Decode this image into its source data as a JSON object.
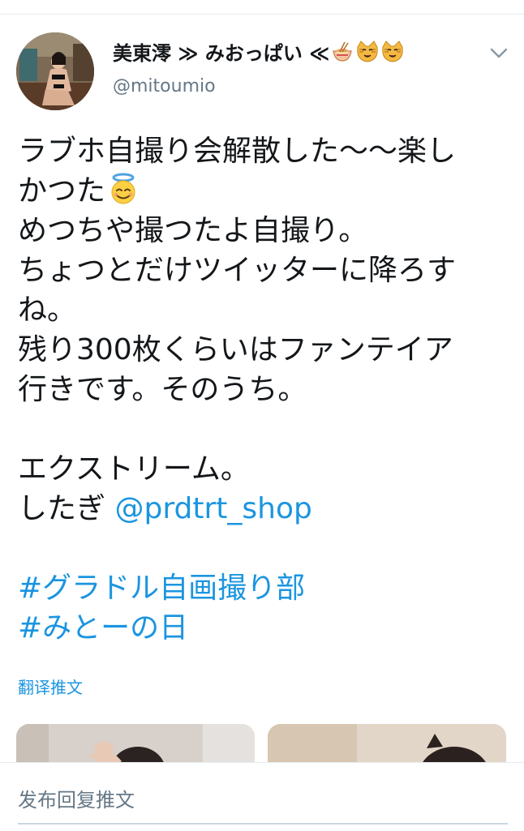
{
  "user": {
    "display_name": "美東澪 ≫ みおっぱい ≪",
    "name_emojis": [
      "ramen-bowl-emoji",
      "cat-face-emoji",
      "cat-face-emoji"
    ],
    "handle": "@mitoumio"
  },
  "tweet": {
    "lines": [
      "ラブホ自撮り会解散した〜〜楽し",
      "かつた",
      "めつちや撮つたよ自撮り。",
      "ちょつとだけツイッターに降ろす",
      "ね。",
      "残り300枚くらいはファンテイア",
      "行きです。そのうち。",
      "エクストリーム。",
      "したぎ"
    ],
    "inline_emoji": "smiling-face-with-halo-emoji",
    "mention": "@prdtrt_shop",
    "hashtags": [
      "#グラドル自画撮り部",
      "#みとーの日"
    ]
  },
  "translate_label": "翻译推文",
  "reply_placeholder": "发布回复推文",
  "colors": {
    "link": "#1b95e0",
    "text": "#14171a",
    "secondary": "#657786",
    "divider": "#e6ecf0"
  }
}
